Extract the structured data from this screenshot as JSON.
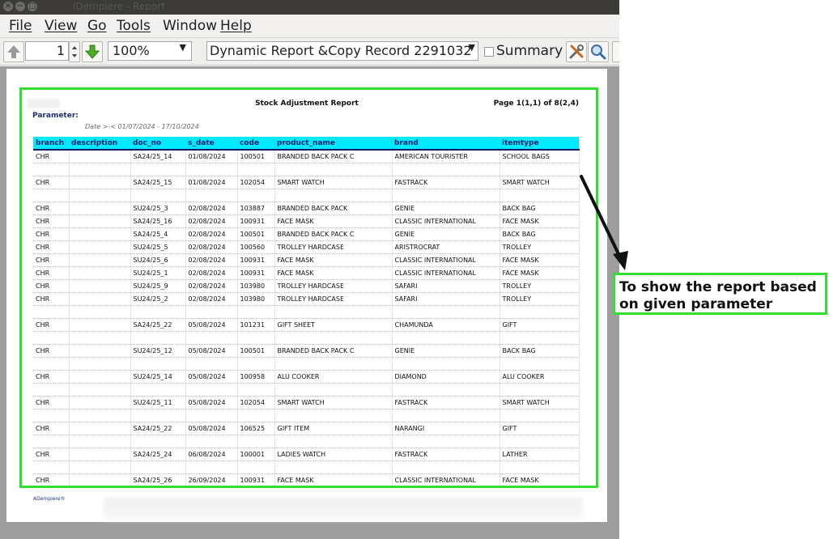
{
  "window": {
    "title": "iDempiere - Report"
  },
  "menubar": {
    "items": [
      {
        "label": "File"
      },
      {
        "label": "View"
      },
      {
        "label": "Go"
      },
      {
        "label": "Tools"
      },
      {
        "label": "Window"
      },
      {
        "label": "Help"
      }
    ]
  },
  "toolbar": {
    "page_value": "1",
    "zoom_value": "100%",
    "report_select": "Dynamic Report &Copy Record 2291032",
    "summary_label": "Summary",
    "icons": [
      "up-arrow-icon",
      "down-arrow-icon",
      "spinner-icon",
      "tools-icon",
      "find-icon"
    ]
  },
  "report": {
    "title": "Stock Adjustment Report",
    "page": "Page 1(1,1) of 8(2,4)",
    "param_label": "Parameter:",
    "param_line": "Date  >-<  01/07/2024 - 17/10/2024",
    "columns": [
      "branch",
      "description",
      "doc_no",
      "s_date",
      "code",
      "product_name",
      "brand",
      "itemtype"
    ],
    "rows": [
      [
        "CHR",
        "",
        "SA24/25_14",
        "01/08/2024",
        "100501",
        "BRANDED BACK PACK C",
        "AMERICAN TOURISTER",
        "SCHOOL BAGS"
      ],
      [
        "",
        "",
        "",
        "",
        "",
        "",
        "",
        ""
      ],
      [
        "CHR",
        "",
        "SA24/25_15",
        "01/08/2024",
        "102054",
        "SMART WATCH",
        "FASTRACK",
        "SMART WATCH"
      ],
      [
        "",
        "",
        "",
        "",
        "",
        "",
        "",
        ""
      ],
      [
        "CHR",
        "",
        "SU24/25_3",
        "02/08/2024",
        "103887",
        "BRANDED BACK PACK",
        "GENIE",
        "BACK BAG"
      ],
      [
        "CHR",
        "",
        "SA24/25_16",
        "02/08/2024",
        "100931",
        "FACE MASK",
        "CLASSIC INTERNATIONAL",
        "FACE MASK"
      ],
      [
        "CHR",
        "",
        "SA24/25_4",
        "02/08/2024",
        "100501",
        "BRANDED BACK PACK C",
        "GENIE",
        "BACK BAG"
      ],
      [
        "CHR",
        "",
        "SU24/25_5",
        "02/08/2024",
        "100560",
        "TROLLEY HARDCASE",
        "ARISTROCRAT",
        "TROLLEY"
      ],
      [
        "CHR",
        "",
        "SU24/25_6",
        "02/08/2024",
        "100931",
        "FACE MASK",
        "CLASSIC INTERNATIONAL",
        "FACE MASK"
      ],
      [
        "CHR",
        "",
        "SU24/25_1",
        "02/08/2024",
        "100931",
        "FACE MASK",
        "CLASSIC INTERNATIONAL",
        "FACE MASK"
      ],
      [
        "CHR",
        "",
        "SU24/25_9",
        "02/08/2024",
        "103980",
        "TROLLEY HARDCASE",
        "SAFARI",
        "TROLLEY"
      ],
      [
        "CHR",
        "",
        "SU24/25_2",
        "02/08/2024",
        "103980",
        "TROLLEY HARDCASE",
        "SAFARI",
        "TROLLEY"
      ],
      [
        "",
        "",
        "",
        "",
        "",
        "",
        "",
        ""
      ],
      [
        "CHR",
        "",
        "SA24/25_22",
        "05/08/2024",
        "101231",
        "GIFT SHEET",
        "CHAMUNDA",
        "GIFT"
      ],
      [
        "",
        "",
        "",
        "",
        "",
        "",
        "",
        ""
      ],
      [
        "CHR",
        "",
        "SU24/25_12",
        "05/08/2024",
        "100501",
        "BRANDED BACK PACK C",
        "GENIE",
        "BACK BAG"
      ],
      [
        "",
        "",
        "",
        "",
        "",
        "",
        "",
        ""
      ],
      [
        "CHR",
        "",
        "SU24/25_14",
        "05/08/2024",
        "100958",
        "ALU COOKER",
        "DIAMOND",
        "ALU COOKER"
      ],
      [
        "",
        "",
        "",
        "",
        "",
        "",
        "",
        ""
      ],
      [
        "CHR",
        "",
        "SU24/25_11",
        "05/08/2024",
        "102054",
        "SMART WATCH",
        "FASTRACK",
        "SMART WATCH"
      ],
      [
        "",
        "",
        "",
        "",
        "",
        "",
        "",
        ""
      ],
      [
        "CHR",
        "",
        "SA24/25_22",
        "05/08/2024",
        "106525",
        "GIFT ITEM",
        "NARANGI",
        "GIFT"
      ],
      [
        "",
        "",
        "",
        "",
        "",
        "",
        "",
        ""
      ],
      [
        "CHR",
        "",
        "SA24/25_24",
        "06/08/2024",
        "100001",
        "LADIES WATCH",
        "FASTRACK",
        "LATHER"
      ],
      [
        "",
        "",
        "",
        "",
        "",
        "",
        "",
        ""
      ],
      [
        "CHR",
        "",
        "SA24/25_26",
        "26/09/2024",
        "100931",
        "FACE MASK",
        "CLASSIC INTERNATIONAL",
        "FACE MASK"
      ]
    ],
    "footer": "ADempiere®"
  },
  "annotation": {
    "text": "To show the report based on given parameter"
  },
  "colors": {
    "highlight": "#33dd33",
    "header_bg": "#00eaff"
  }
}
